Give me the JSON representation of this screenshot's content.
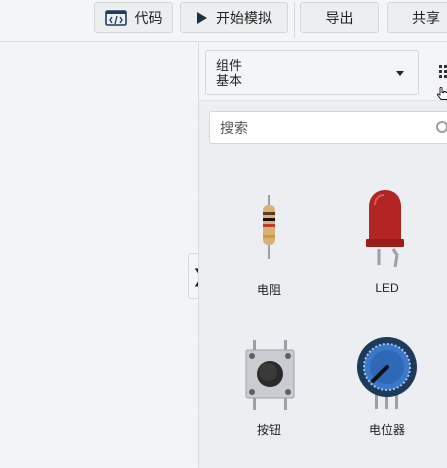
{
  "toolbar": {
    "code_label": "代码",
    "simulate_label": "开始模拟",
    "export_label": "导出",
    "share_label": "共享"
  },
  "panel": {
    "category_heading": "组件",
    "category_value": "基本",
    "search_placeholder": "搜索",
    "toggle_glyph": "❯",
    "components": [
      {
        "label": "电阻",
        "icon": "resistor-icon"
      },
      {
        "label": "LED",
        "icon": "led-icon"
      },
      {
        "label": "按钮",
        "icon": "pushbutton-icon"
      },
      {
        "label": "电位器",
        "icon": "potentiometer-icon"
      }
    ]
  },
  "colors": {
    "led_red": "#b32424",
    "pot_blue": "#3a78c9",
    "resistor_body": "#d9b07a"
  }
}
